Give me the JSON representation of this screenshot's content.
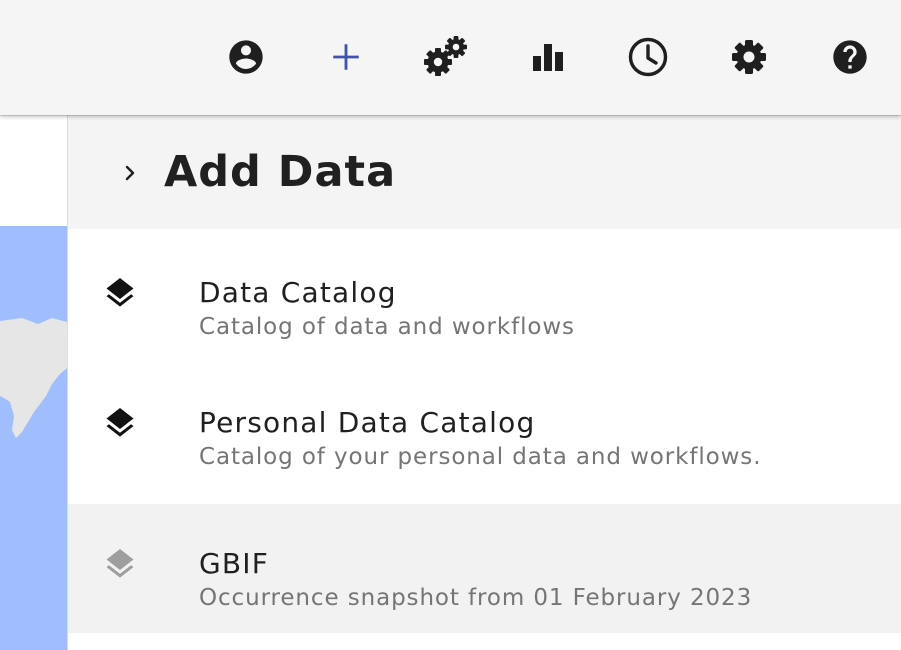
{
  "toolbar": {
    "buttons": [
      {
        "icon": "account-circle-icon",
        "label": ""
      },
      {
        "icon": "plus-icon",
        "label": "",
        "color": "#3f51b5"
      },
      {
        "icon": "workflow-gears-icon",
        "label": ""
      },
      {
        "icon": "bar-chart-icon",
        "label": ""
      },
      {
        "icon": "clock-icon",
        "label": ""
      },
      {
        "icon": "settings-gear-icon",
        "label": ""
      },
      {
        "icon": "help-circle-icon",
        "label": ""
      }
    ]
  },
  "panel": {
    "title": "Add Data",
    "items": [
      {
        "title": "Data Catalog",
        "subtitle": "Catalog of data and workflows",
        "icon": "layers-icon"
      },
      {
        "title": "Personal Data Catalog",
        "subtitle": "Catalog of your personal data and workflows.",
        "icon": "layers-icon"
      },
      {
        "title": "GBIF",
        "subtitle": "Occurrence snapshot from 01 February 2023",
        "icon": "layers-outline-icon",
        "highlighted": true
      }
    ]
  },
  "colors": {
    "toolbar_bg": "#f5f5f5",
    "accent": "#3f51b5",
    "ocean": "#a0bdfd",
    "land": "#e6e6e6",
    "highlight_bg": "#f2f2f2"
  }
}
